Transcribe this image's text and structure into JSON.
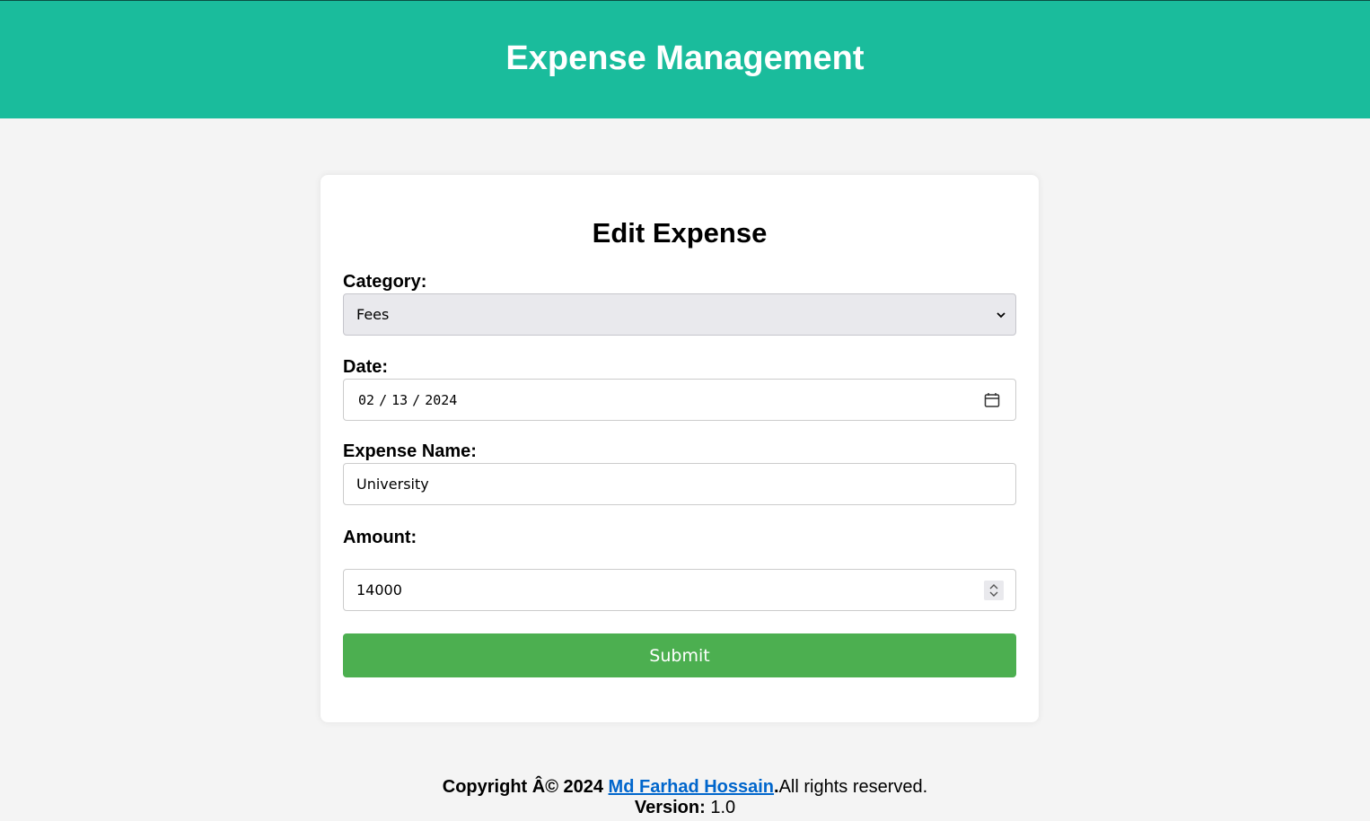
{
  "header": {
    "title": "Expense Management"
  },
  "form": {
    "title": "Edit Expense",
    "category": {
      "label": "Category:",
      "value": "Fees"
    },
    "date": {
      "label": "Date:",
      "month": "02",
      "day": "13",
      "year": "2024",
      "separator": "/"
    },
    "expense_name": {
      "label": "Expense Name:",
      "value": "University"
    },
    "amount": {
      "label": "Amount:",
      "value": "14000"
    },
    "submit_label": "Submit"
  },
  "footer": {
    "copyright_prefix": "Copyright Â© 2024",
    "author_link": "Md Farhad Hossain",
    "rights": ".All rights reserved.",
    "version_label": "Version:",
    "version_value": "1.0"
  },
  "colors": {
    "header_bg": "#1abc9c",
    "submit_bg": "#4caf50",
    "link": "#0066cc"
  },
  "icons": {
    "select_chevron": "chevron-down-icon",
    "date_picker": "calendar-icon",
    "number_spinner": "spinner-icon"
  }
}
